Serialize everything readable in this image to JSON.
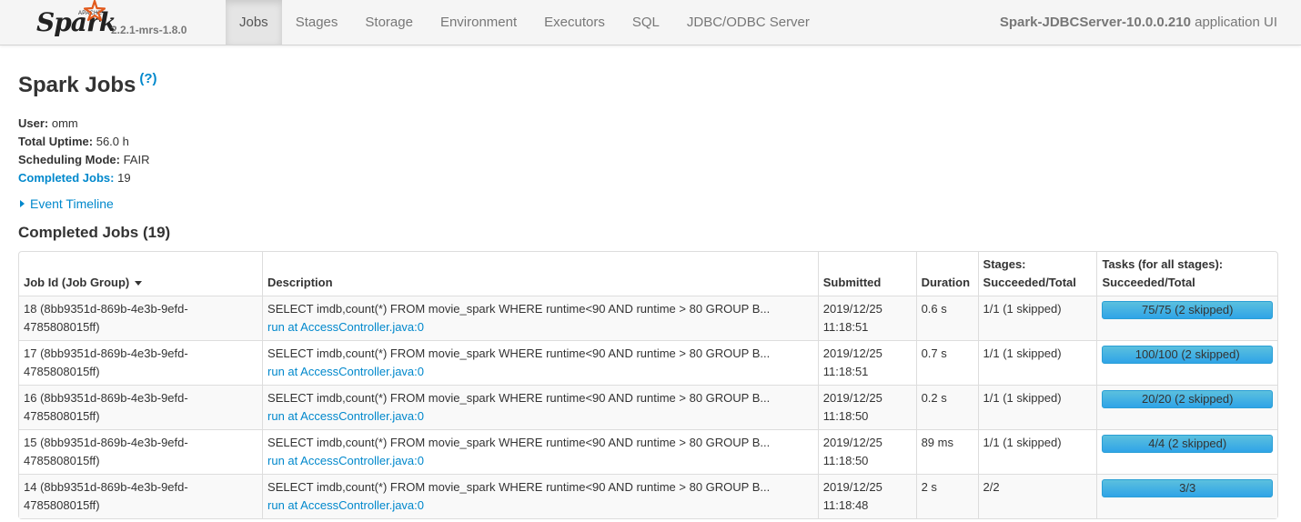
{
  "navbar": {
    "logo": {
      "apache": "APACHE",
      "spark": "Spark"
    },
    "version": "2.2.1-mrs-1.8.0",
    "tabs": [
      {
        "label": "Jobs",
        "active": true
      },
      {
        "label": "Stages",
        "active": false
      },
      {
        "label": "Storage",
        "active": false
      },
      {
        "label": "Environment",
        "active": false
      },
      {
        "label": "Executors",
        "active": false
      },
      {
        "label": "SQL",
        "active": false
      },
      {
        "label": "JDBC/ODBC Server",
        "active": false
      }
    ],
    "app_name": "Spark-JDBCServer-10.0.0.210",
    "app_suffix": " application UI"
  },
  "page": {
    "title": "Spark Jobs",
    "help": "(?)",
    "summary": {
      "user_label": "User:",
      "user": "omm",
      "uptime_label": "Total Uptime:",
      "uptime": "56.0 h",
      "mode_label": "Scheduling Mode:",
      "mode": "FAIR",
      "completed_label": "Completed Jobs:",
      "completed": "19"
    },
    "event_timeline": "Event Timeline",
    "section_title": "Completed Jobs (19)"
  },
  "table": {
    "headers": {
      "job_id": "Job Id (Job Group)",
      "description": "Description",
      "submitted": "Submitted",
      "duration": "Duration",
      "stages_1": "Stages:",
      "stages_2": "Succeeded/Total",
      "tasks_1": "Tasks (for all stages):",
      "tasks_2": "Succeeded/Total"
    },
    "rows": [
      {
        "job_a": "18 (8bb9351d-869b-4e3b-9efd-",
        "job_b": "4785808015ff)",
        "sql": "SELECT imdb,count(*) FROM movie_spark WHERE runtime<90 AND runtime > 80 GROUP B...",
        "link": "run at AccessController.java:0",
        "date": "2019/12/25",
        "time": "11:18:51",
        "duration": "0.6 s",
        "stages": "1/1 (1 skipped)",
        "tasks": "75/75 (2 skipped)",
        "progress": 1.0
      },
      {
        "job_a": "17 (8bb9351d-869b-4e3b-9efd-",
        "job_b": "4785808015ff)",
        "sql": "SELECT imdb,count(*) FROM movie_spark WHERE runtime<90 AND runtime > 80 GROUP B...",
        "link": "run at AccessController.java:0",
        "date": "2019/12/25",
        "time": "11:18:51",
        "duration": "0.7 s",
        "stages": "1/1 (1 skipped)",
        "tasks": "100/100 (2 skipped)",
        "progress": 1.0
      },
      {
        "job_a": "16 (8bb9351d-869b-4e3b-9efd-",
        "job_b": "4785808015ff)",
        "sql": "SELECT imdb,count(*) FROM movie_spark WHERE runtime<90 AND runtime > 80 GROUP B...",
        "link": "run at AccessController.java:0",
        "date": "2019/12/25",
        "time": "11:18:50",
        "duration": "0.2 s",
        "stages": "1/1 (1 skipped)",
        "tasks": "20/20 (2 skipped)",
        "progress": 1.0
      },
      {
        "job_a": "15 (8bb9351d-869b-4e3b-9efd-",
        "job_b": "4785808015ff)",
        "sql": "SELECT imdb,count(*) FROM movie_spark WHERE runtime<90 AND runtime > 80 GROUP B...",
        "link": "run at AccessController.java:0",
        "date": "2019/12/25",
        "time": "11:18:50",
        "duration": "89 ms",
        "stages": "1/1 (1 skipped)",
        "tasks": "4/4 (2 skipped)",
        "progress": 1.0
      },
      {
        "job_a": "14 (8bb9351d-869b-4e3b-9efd-",
        "job_b": "4785808015ff)",
        "sql": "SELECT imdb,count(*) FROM movie_spark WHERE runtime<90 AND runtime > 80 GROUP B...",
        "link": "run at AccessController.java:0",
        "date": "2019/12/25",
        "time": "11:18:48",
        "duration": "2 s",
        "stages": "2/2",
        "tasks": "3/3",
        "progress": 1.0
      }
    ]
  },
  "colors": {
    "link": "#0088cc",
    "progress": "#2fa4e7",
    "logo_star": "#e25a1c"
  }
}
